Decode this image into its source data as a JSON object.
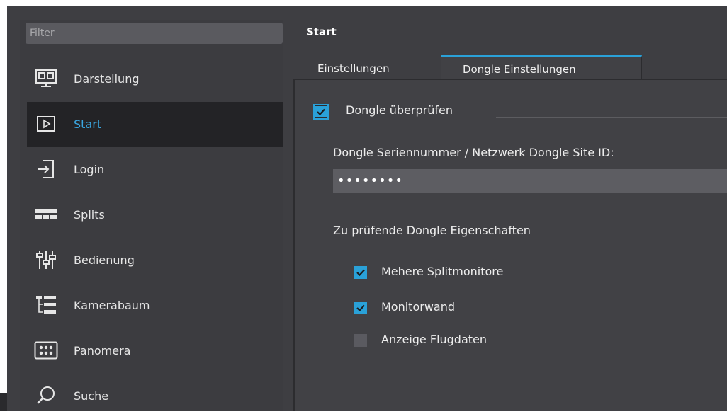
{
  "filter": {
    "placeholder": "Filter"
  },
  "sidebar": {
    "items": [
      {
        "label": "Darstellung",
        "icon": "monitor-icon",
        "active": false
      },
      {
        "label": "Start",
        "icon": "play-icon",
        "active": true
      },
      {
        "label": "Login",
        "icon": "login-icon",
        "active": false
      },
      {
        "label": "Splits",
        "icon": "splits-icon",
        "active": false
      },
      {
        "label": "Bedienung",
        "icon": "sliders-icon",
        "active": false
      },
      {
        "label": "Kamerabaum",
        "icon": "tree-icon",
        "active": false
      },
      {
        "label": "Panomera",
        "icon": "grid-icon",
        "active": false
      },
      {
        "label": "Suche",
        "icon": "search-icon",
        "active": false
      }
    ]
  },
  "main": {
    "title": "Start",
    "tabs": [
      {
        "label": "Einstellungen",
        "active": false
      },
      {
        "label": "Dongle Einstellungen",
        "active": true
      }
    ],
    "dongle_check": {
      "label": "Dongle überprüfen",
      "checked": true
    },
    "serial_label": "Dongle Seriennummer / Netzwerk Dongle Site ID:",
    "serial_value": "••••••••",
    "properties_heading": "Zu prüfende Dongle Eigenschaften",
    "properties": [
      {
        "label": "Mehere Splitmonitore",
        "checked": true
      },
      {
        "label": "Monitorwand",
        "checked": true
      },
      {
        "label": "Anzeige Flugdaten",
        "checked": false
      }
    ]
  },
  "colors": {
    "accent": "#2aa1d8",
    "background": "#3e3e42",
    "active_item_bg": "#232326"
  }
}
